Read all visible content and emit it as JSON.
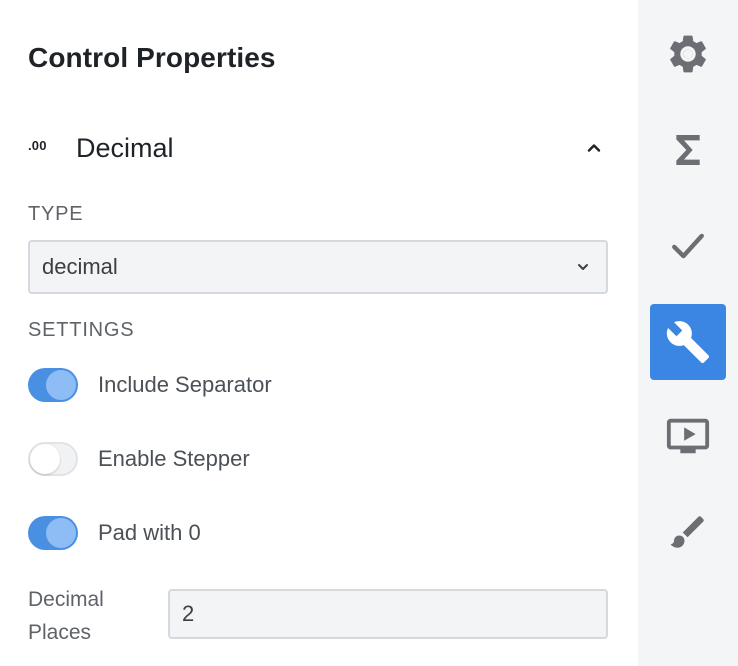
{
  "panel": {
    "title": "Control Properties",
    "section": {
      "icon_text": ".00",
      "title": "Decimal"
    },
    "type": {
      "label": "TYPE",
      "value": "decimal"
    },
    "settings": {
      "label": "SETTINGS",
      "toggles": [
        {
          "label": "Include Separator",
          "state": "on"
        },
        {
          "label": "Enable Stepper",
          "state": "off"
        },
        {
          "label": "Pad with 0",
          "state": "on"
        }
      ]
    },
    "decimal_places": {
      "label": "Decimal Places",
      "value": "2"
    }
  },
  "rail": {
    "items": [
      {
        "icon": "gear-icon",
        "active": false
      },
      {
        "icon": "sigma-icon",
        "active": false
      },
      {
        "icon": "check-icon",
        "active": false
      },
      {
        "icon": "wrench-icon",
        "active": true
      },
      {
        "icon": "preview-icon",
        "active": false
      },
      {
        "icon": "brush-icon",
        "active": false
      }
    ]
  },
  "colors": {
    "accent": "#3c86e3",
    "toggle_on": "#4a90e2",
    "rail_bg": "#f4f5f7",
    "icon_gray": "#6b6f74"
  }
}
